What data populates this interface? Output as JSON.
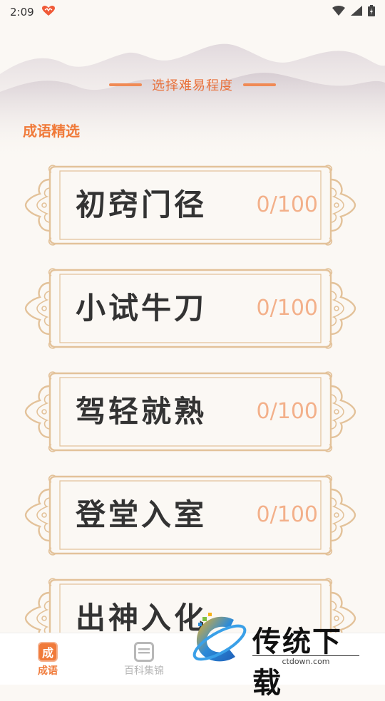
{
  "status_bar": {
    "time": "2:09"
  },
  "header": {
    "title": "选择难易程度"
  },
  "section": {
    "title": "成语精选"
  },
  "levels": [
    {
      "name": "初窍门径",
      "progress": "0/100"
    },
    {
      "name": "小试牛刀",
      "progress": "0/100"
    },
    {
      "name": "驾轻就熟",
      "progress": "0/100"
    },
    {
      "name": "登堂入室",
      "progress": "0/100"
    },
    {
      "name": "出神入化",
      "progress": ""
    }
  ],
  "bottom_nav": {
    "items": [
      {
        "label": "成语",
        "icon": "成",
        "active": true
      },
      {
        "label": "百科集锦",
        "icon": "book-icon",
        "active": false
      }
    ]
  },
  "watermark": {
    "text": "传统下载",
    "url": "ctdown.com"
  },
  "colors": {
    "accent": "#f07a3a",
    "progress": "#f3b08a",
    "frame": "#e3c29a",
    "nav_active": "#f07a3a",
    "nav_inactive": "#b8b8b8"
  }
}
